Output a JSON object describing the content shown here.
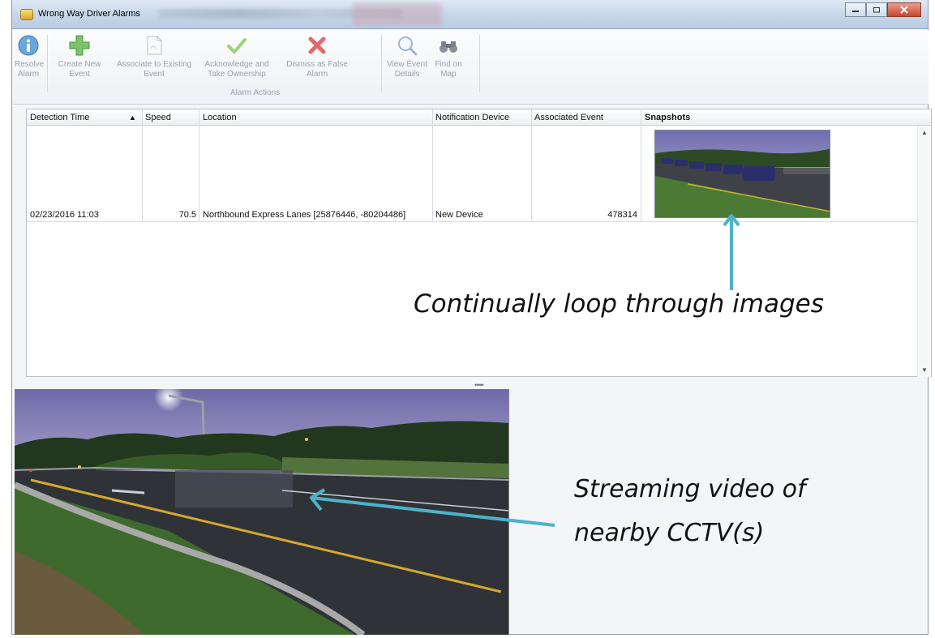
{
  "window": {
    "title": "Wrong Way Driver Alarms",
    "controls": [
      "minimize-icon",
      "maximize-icon",
      "close-icon"
    ]
  },
  "ribbon": {
    "buttons": [
      {
        "icon": "info-icon",
        "label": "Resolve\nAlarm"
      },
      {
        "icon": "plus-icon",
        "label": "Create New\nEvent"
      },
      {
        "icon": "document-link-icon",
        "label": "Associate to Existing\nEvent"
      },
      {
        "icon": "checkmark-icon",
        "label": "Acknowledge and\nTake Ownership"
      },
      {
        "icon": "red-x-icon",
        "label": "Dismiss as False\nAlarm"
      },
      {
        "icon": "magnifier-icon",
        "label": "View Event\nDetails"
      },
      {
        "icon": "binoculars-icon",
        "label": "Find on\nMap"
      }
    ],
    "group_label": "Alarm Actions"
  },
  "grid": {
    "columns": [
      "Detection Time",
      "Speed",
      "Location",
      "Notification Device",
      "Associated Event",
      "Snapshots"
    ],
    "sorted_column": "Detection Time",
    "sort_indicator": "▲",
    "rows": [
      {
        "detection_time": "02/23/2016 11:03",
        "speed": "70.5",
        "location": "Northbound Express Lanes [25876446, -80204486]",
        "notification_device": "New Device",
        "associated_event": "478314"
      }
    ]
  },
  "splitter_glyph": "•••••",
  "annotations": {
    "snapshots_note": "Continually loop through images",
    "video_note_line1": "Streaming video of",
    "video_note_line2": "nearby CCTV(s)"
  },
  "colors": {
    "annotation_arrow": "#4cb3c9",
    "title_bar": "#c5d6ea",
    "close_button": "#c9452e"
  }
}
